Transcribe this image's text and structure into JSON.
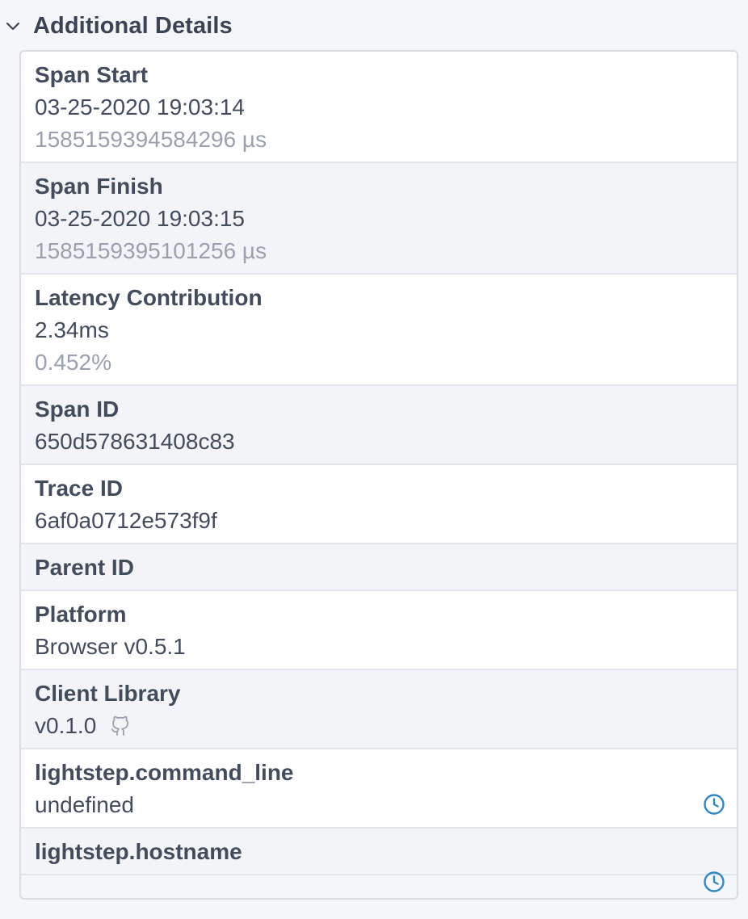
{
  "section": {
    "title": "Additional Details"
  },
  "rows": [
    {
      "label": "Span Start",
      "value": "03-25-2020 19:03:14",
      "sub": "1585159394584296 µs"
    },
    {
      "label": "Span Finish",
      "value": "03-25-2020 19:03:15",
      "sub": "1585159395101256 µs"
    },
    {
      "label": "Latency Contribution",
      "value": "2.34ms",
      "sub": "0.452%"
    },
    {
      "label": "Span ID",
      "value": "650d578631408c83"
    },
    {
      "label": "Trace ID",
      "value": "6af0a0712e573f9f"
    },
    {
      "label": "Parent ID"
    },
    {
      "label": "Platform",
      "value": "Browser v0.5.1"
    },
    {
      "label": "Client Library",
      "value": "v0.1.0"
    },
    {
      "label": "lightstep.command_line",
      "value": "undefined"
    },
    {
      "label": "lightstep.hostname"
    }
  ],
  "icons": {
    "section_toggle": "chevron-down-icon",
    "client_library_link": "github-icon",
    "history": "clock-icon"
  },
  "colors": {
    "link": "#2f89c9",
    "muted_text": "#9aa1ad",
    "text": "#434c5d"
  }
}
